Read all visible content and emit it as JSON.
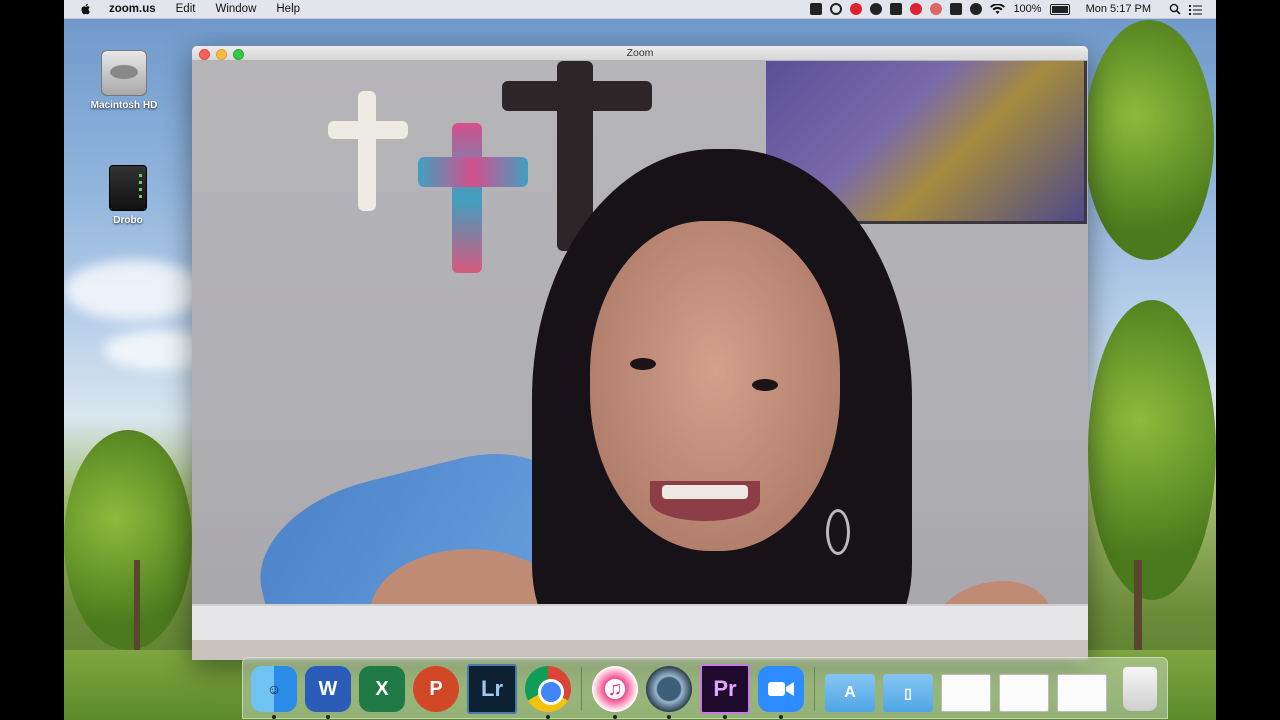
{
  "menubar": {
    "app_name": "zoom.us",
    "menus": [
      "Edit",
      "Window",
      "Help"
    ],
    "battery_percent": "100%",
    "clock": "Mon 5:17 PM"
  },
  "desktop": {
    "icons": [
      {
        "label": "Macintosh HD",
        "icon": "hard-drive-icon"
      },
      {
        "label": "Drobo",
        "icon": "drobo-drive-icon"
      }
    ]
  },
  "window": {
    "title": "Zoom"
  },
  "dock": {
    "apps": [
      {
        "name": "Finder",
        "glyph": ""
      },
      {
        "name": "Microsoft Word",
        "glyph": "W"
      },
      {
        "name": "Microsoft Excel",
        "glyph": "X"
      },
      {
        "name": "Microsoft PowerPoint",
        "glyph": "P"
      },
      {
        "name": "Lightroom",
        "glyph": "Lr"
      },
      {
        "name": "Google Chrome",
        "glyph": ""
      },
      {
        "name": "iTunes",
        "glyph": "♫"
      },
      {
        "name": "QuickTime",
        "glyph": ""
      },
      {
        "name": "Premiere Pro",
        "glyph": "Pr"
      },
      {
        "name": "Zoom",
        "glyph": "■"
      }
    ]
  }
}
